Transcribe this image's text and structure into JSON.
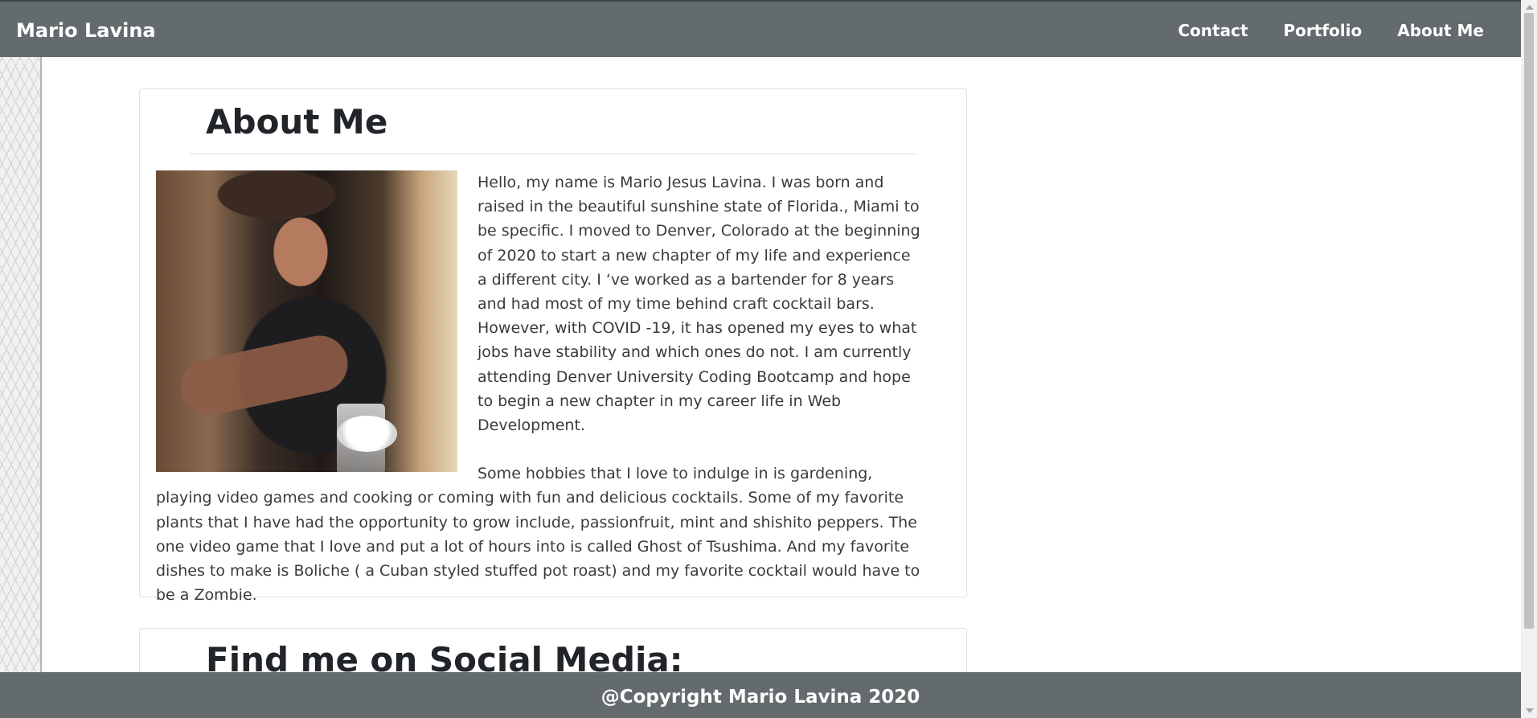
{
  "navbar": {
    "brand": "Mario Lavina",
    "links": [
      "Contact",
      "Portfolio",
      "About Me"
    ]
  },
  "about": {
    "title": "About Me",
    "photo_icon": "bartender-photo",
    "paragraphs": [
      "Hello, my name is Mario Jesus Lavina. I was born and raised in the beautiful sunshine state of Florida., Miami to be specific. I moved to Denver, Colorado at the beginning of 2020 to start a new chapter of my life and experience a different city. I ‘ve worked as a bartender for 8 years and had most of my time behind craft cocktail bars. However, with COVID -19, it has opened my eyes to what jobs have stability and which ones do not. I am currently attending Denver University Coding Bootcamp and hope to begin a new chapter in my career life in Web Development.",
      "Some hobbies that I love to indulge in is gardening, playing video games and cooking or coming with fun and delicious cocktails. Some of my favorite plants that I have had the opportunity to grow include, passionfruit, mint and shishito peppers. The one video game that I love and put a lot of hours into is called Ghost of Tsushima. And my favorite dishes to make is Boliche ( a Cuban styled stuffed pot roast) and my favorite cocktail would have to be a Zombie."
    ]
  },
  "social": {
    "title": "Find me on Social Media:"
  },
  "footer": {
    "text": "@Copyright Mario Lavina 2020"
  },
  "colors": {
    "nav_bg": "#636b6d",
    "footer_bg": "#636b6d"
  }
}
